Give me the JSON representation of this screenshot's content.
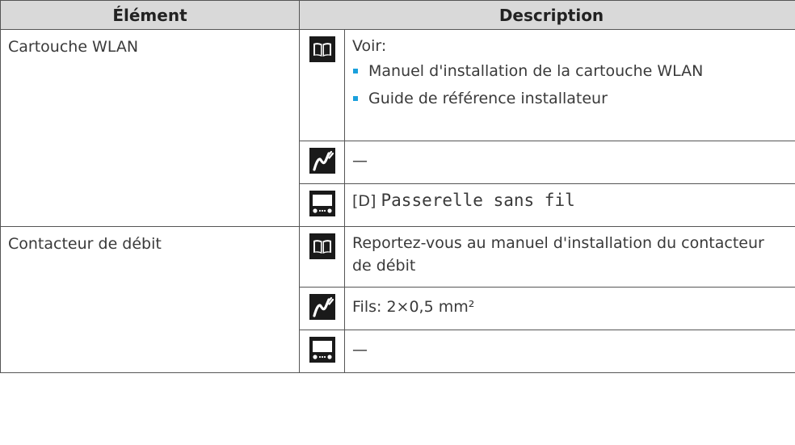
{
  "header": {
    "col_element": "Élément",
    "col_description": "Description"
  },
  "rows": [
    {
      "element": "Cartouche WLAN",
      "manual": {
        "text": "Voir:",
        "bullets": [
          "Manuel d'installation de la cartouche WLAN",
          "Guide de référence installateur"
        ]
      },
      "wiring": {
        "text": "—"
      },
      "ui": {
        "prefix": "[D]",
        "mono": "Passerelle sans fil"
      }
    },
    {
      "element": "Contacteur de débit",
      "manual": {
        "text": "Reportez-vous au manuel d'installation du contacteur de débit"
      },
      "wiring": {
        "text": "Fils: 2×0,5 mm²"
      },
      "ui": {
        "text": "—"
      }
    }
  ],
  "icons": {
    "manual": "book-icon",
    "wiring": "wire-icon",
    "ui": "remote-controller-icon"
  },
  "colors": {
    "header_bg": "#d9d9d9",
    "bullet": "#1aa0dc",
    "icon_bg": "#1a1a1a"
  }
}
